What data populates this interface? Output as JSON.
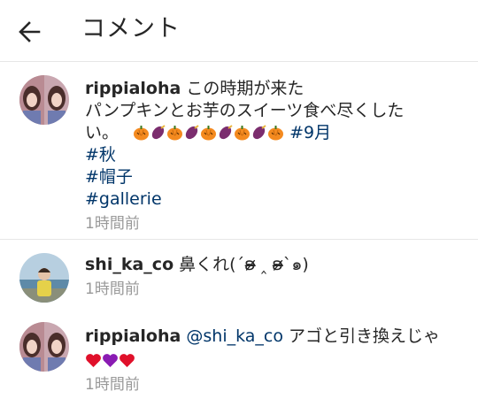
{
  "header": {
    "title": "コメント"
  },
  "caption": {
    "username": "rippialoha",
    "text_line1": "この時期が来た",
    "text_line2": "パンプキンとお芋のスイーツ食べ尽くした",
    "text_line3": "い。",
    "hashtags_inline": "#9月",
    "hashtags": [
      "#秋",
      "#帽子",
      "#gallerie"
    ],
    "time": "1時間前",
    "emoji": [
      "pumpkin-emoji",
      "sweet-potato-emoji",
      "pumpkin-emoji",
      "sweet-potato-emoji",
      "pumpkin-emoji",
      "sweet-potato-emoji",
      "pumpkin-emoji",
      "sweet-potato-emoji",
      "pumpkin-emoji"
    ]
  },
  "comments": [
    {
      "username": "shi_ka_co",
      "text": "鼻くれ(´ʚ̴̶̷̷ ‸ ʚ̴̶̷̷`๑)",
      "time": "1時間前"
    },
    {
      "username": "rippialoha",
      "mention": "@shi_ka_co",
      "text": "アゴと引き換えじゃ",
      "time": "1時間前",
      "emoji": [
        "red-heart-emoji",
        "purple-heart-emoji",
        "red-heart-emoji"
      ]
    }
  ],
  "colors": {
    "link": "#003569",
    "meta": "#999999",
    "divider": "#e6e6e6",
    "pumpkin": "#f48a1f",
    "sweet_potato": "#7b2d6e"
  }
}
